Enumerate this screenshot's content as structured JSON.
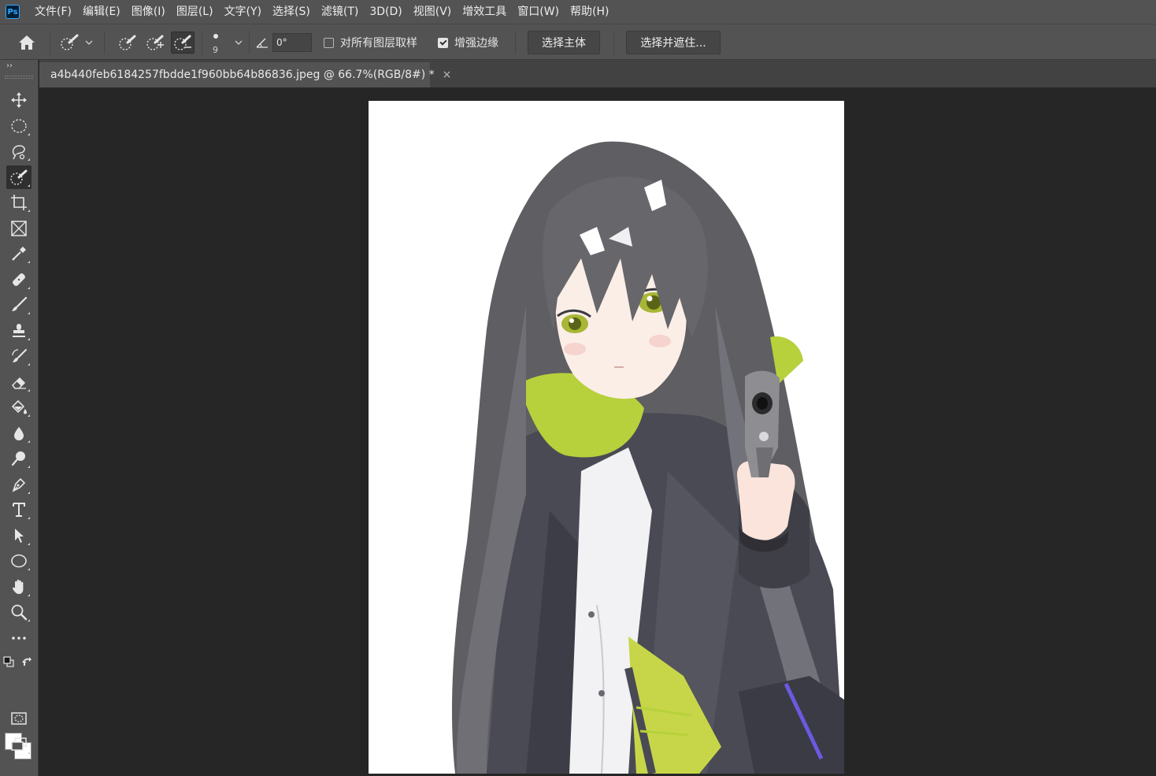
{
  "app": {
    "logo": "Ps",
    "menu": [
      "文件(F)",
      "编辑(E)",
      "图像(I)",
      "图层(L)",
      "文字(Y)",
      "选择(S)",
      "滤镜(T)",
      "3D(D)",
      "视图(V)",
      "增效工具",
      "窗口(W)",
      "帮助(H)"
    ]
  },
  "options": {
    "brush_size": "9",
    "angle": "0°",
    "sample_all_layers": {
      "label": "对所有图层取样",
      "checked": false
    },
    "enhance_edge": {
      "label": "增强边缘",
      "checked": true
    },
    "select_subject": "选择主体",
    "select_and_mask": "选择并遮住..."
  },
  "toolbar": {
    "collapse": "››",
    "active_tool": "quick-selection-tool",
    "foreground_color": "#ffffff",
    "background_color": "#ffffff"
  },
  "document": {
    "tab_title": "a4b440feb6184257fbdde1f960bb64b86836.jpeg @ 66.7%(RGB/8#) *",
    "close": "×"
  },
  "colors": {
    "ui_panel": "#535353",
    "workspace": "#262626",
    "hair": "#66666b",
    "coat": "#4a4a55",
    "scarf": "#b6d13c",
    "eyes": "#a8b636"
  }
}
